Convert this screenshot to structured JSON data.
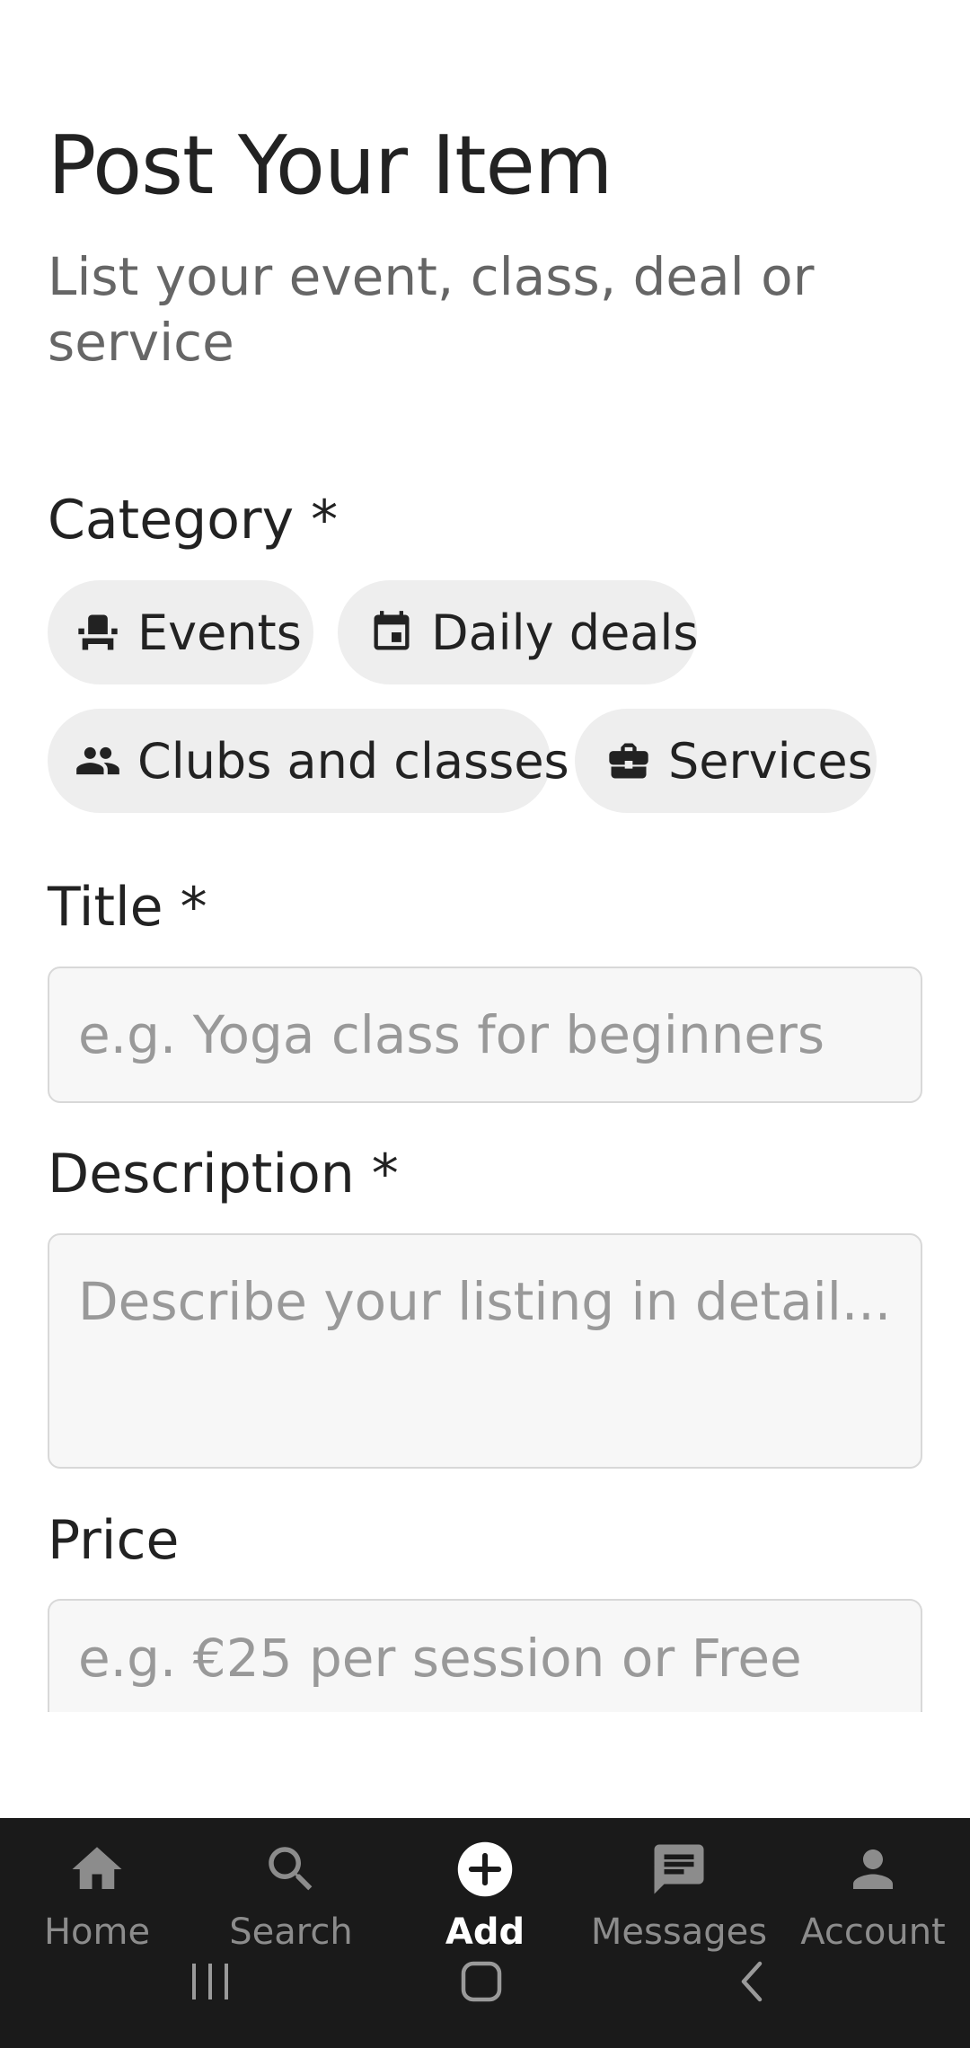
{
  "header": {
    "title": "Post Your Item",
    "subtitle": "List your event, class, deal or service"
  },
  "form": {
    "category": {
      "label": "Category *",
      "chips": [
        {
          "label": "Events",
          "icon": "event-seat-icon"
        },
        {
          "label": "Daily deals",
          "icon": "calendar-icon"
        },
        {
          "label": "Clubs and classes",
          "icon": "people-icon"
        },
        {
          "label": "Services",
          "icon": "briefcase-icon"
        }
      ]
    },
    "title": {
      "label": "Title *",
      "placeholder": "e.g. Yoga class for beginners"
    },
    "description": {
      "label": "Description *",
      "placeholder": "Describe your listing in detail..."
    },
    "price": {
      "label": "Price",
      "placeholder": "e.g. €25 per session or Free"
    }
  },
  "bottom_nav": {
    "items": [
      {
        "label": "Home",
        "icon": "home-icon",
        "active": false
      },
      {
        "label": "Search",
        "icon": "search-icon",
        "active": false
      },
      {
        "label": "Add",
        "icon": "add-icon",
        "active": true
      },
      {
        "label": "Messages",
        "icon": "messages-icon",
        "active": false
      },
      {
        "label": "Account",
        "icon": "account-icon",
        "active": false
      }
    ]
  },
  "system_nav": {
    "icons": [
      "recent-apps-icon",
      "home-button-icon",
      "back-icon"
    ]
  },
  "colors": {
    "chip_bg": "#eeeeee",
    "field_bg": "#f7f7f7",
    "field_border": "#d8d8d8",
    "nav_bg": "#1a1a1a",
    "nav_inactive": "#8c8c8c",
    "nav_active": "#ffffff"
  }
}
